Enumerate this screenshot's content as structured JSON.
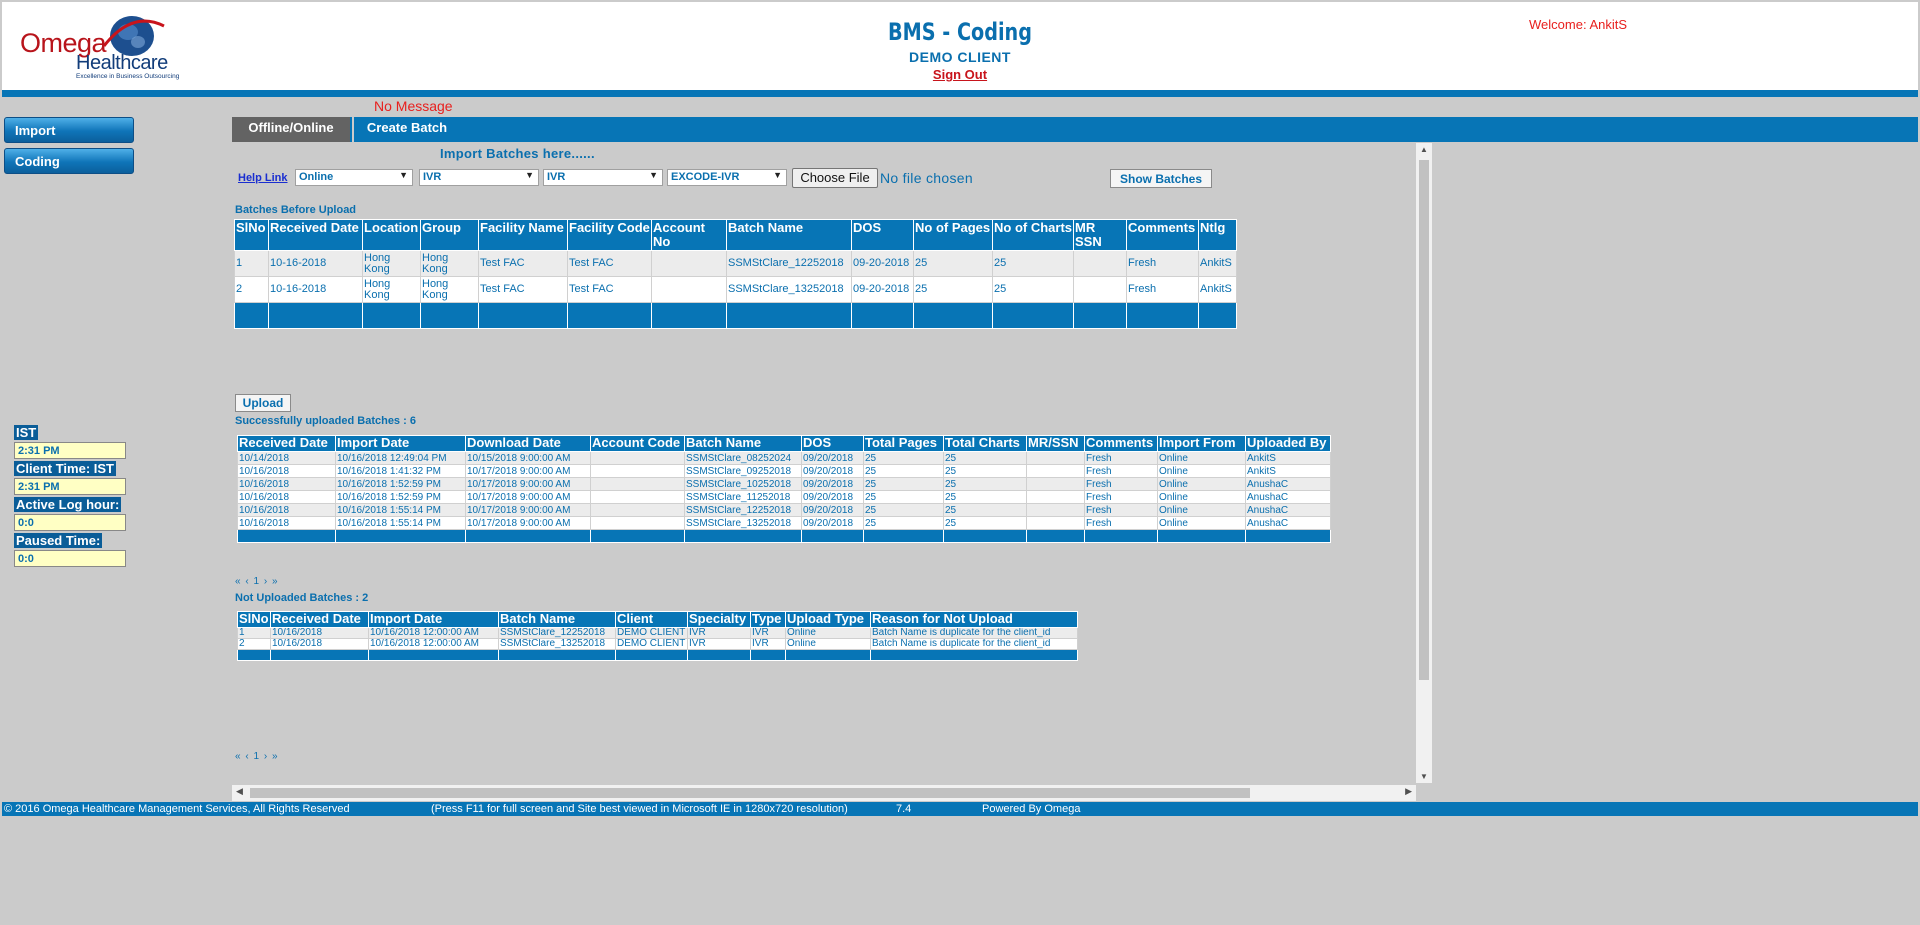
{
  "header": {
    "logo_line1": "Omega",
    "logo_line2": "Healthcare",
    "logo_tagline": "Excellence in Business Outsourcing",
    "app_title": "BMS - Coding",
    "client_name": "DEMO CLIENT",
    "sign_out": "Sign Out",
    "welcome": "Welcome: AnkitS"
  },
  "nav": {
    "import": "Import",
    "coding": "Coding"
  },
  "message": "No Message",
  "tabs": {
    "offline_online": "Offline/Online",
    "create_batch": "Create Batch"
  },
  "import_form": {
    "heading": "Import Batches here......",
    "help_link": "Help Link",
    "mode": "Online",
    "specialty": "IVR",
    "type": "IVR",
    "client": "EXCODE-IVR",
    "choose_file": "Choose File",
    "file_status": "No file chosen",
    "show_batches": "Show Batches"
  },
  "before_upload": {
    "label": "Batches Before Upload",
    "headers": [
      "SlNo",
      "Received Date",
      "Location",
      "Group",
      "Facility Name",
      "Facility Code",
      "Account No",
      "Batch Name",
      "DOS",
      "No of Pages",
      "No of Charts",
      "MR SSN",
      "Comments",
      "Ntlg"
    ],
    "rows": [
      [
        "1",
        "10-16-2018",
        "Hong Kong",
        "Hong Kong",
        "Test FAC",
        "Test FAC",
        "",
        "SSMStClare_12252018",
        "09-20-2018",
        "25",
        "25",
        "",
        "Fresh",
        "AnkitS"
      ],
      [
        "2",
        "10-16-2018",
        "Hong Kong",
        "Hong Kong",
        "Test FAC",
        "Test FAC",
        "",
        "SSMStClare_13252018",
        "09-20-2018",
        "25",
        "25",
        "",
        "Fresh",
        "AnkitS"
      ]
    ]
  },
  "upload_button": "Upload",
  "success": {
    "label": "Successfully uploaded Batches : 6",
    "headers": [
      "Received Date",
      "Import Date",
      "Download Date",
      "Account Code",
      "Batch Name",
      "DOS",
      "Total Pages",
      "Total Charts",
      "MR/SSN",
      "Comments",
      "Import From",
      "Uploaded By"
    ],
    "rows": [
      [
        "10/14/2018",
        "10/16/2018 12:49:04 PM",
        "10/15/2018 9:00:00 AM",
        "",
        "SSMStClare_08252024",
        "09/20/2018",
        "25",
        "25",
        "",
        "Fresh",
        "Online",
        "AnkitS"
      ],
      [
        "10/16/2018",
        "10/16/2018 1:41:32 PM",
        "10/17/2018 9:00:00 AM",
        "",
        "SSMStClare_09252018",
        "09/20/2018",
        "25",
        "25",
        "",
        "Fresh",
        "Online",
        "AnkitS"
      ],
      [
        "10/16/2018",
        "10/16/2018 1:52:59 PM",
        "10/17/2018 9:00:00 AM",
        "",
        "SSMStClare_10252018",
        "09/20/2018",
        "25",
        "25",
        "",
        "Fresh",
        "Online",
        "AnushaC"
      ],
      [
        "10/16/2018",
        "10/16/2018 1:52:59 PM",
        "10/17/2018 9:00:00 AM",
        "",
        "SSMStClare_11252018",
        "09/20/2018",
        "25",
        "25",
        "",
        "Fresh",
        "Online",
        "AnushaC"
      ],
      [
        "10/16/2018",
        "10/16/2018 1:55:14 PM",
        "10/17/2018 9:00:00 AM",
        "",
        "SSMStClare_12252018",
        "09/20/2018",
        "25",
        "25",
        "",
        "Fresh",
        "Online",
        "AnushaC"
      ],
      [
        "10/16/2018",
        "10/16/2018 1:55:14 PM",
        "10/17/2018 9:00:00 AM",
        "",
        "SSMStClare_13252018",
        "09/20/2018",
        "25",
        "25",
        "",
        "Fresh",
        "Online",
        "AnushaC"
      ]
    ]
  },
  "pager1": {
    "first": "«",
    "prev": "‹",
    "page": "1",
    "next": "›",
    "last": "»"
  },
  "not_uploaded": {
    "label": "Not Uploaded Batches : 2",
    "headers": [
      "SlNo",
      "Received Date",
      "Import Date",
      "Batch Name",
      "Client",
      "Specialty",
      "Type",
      "Upload Type",
      "Reason for Not Upload"
    ],
    "rows": [
      [
        "1",
        "10/16/2018",
        "10/16/2018 12:00:00 AM",
        "SSMStClare_12252018",
        "DEMO CLIENT",
        "IVR",
        "IVR",
        "Online",
        "Batch Name is duplicate for the client_id"
      ],
      [
        "2",
        "10/16/2018",
        "10/16/2018 12:00:00 AM",
        "SSMStClare_13252018",
        "DEMO CLIENT",
        "IVR",
        "IVR",
        "Online",
        "Batch Name is duplicate for the client_id"
      ]
    ]
  },
  "pager2": {
    "first": "«",
    "prev": "‹",
    "page": "1",
    "next": "›",
    "last": "»"
  },
  "timing": {
    "ist_label": "IST",
    "ist_value": "2:31 PM",
    "client_time_label": "Client Time: IST",
    "client_time_value": "2:31 PM",
    "active_log_label": "Active Log hour:",
    "active_log_value": "0:0",
    "paused_label": "Paused Time:",
    "paused_value": "0:0"
  },
  "footer": {
    "copyright": "© 2016 Omega Healthcare Management Services, All Rights Reserved",
    "notice": "(Press F11 for full screen and Site best viewed in Microsoft IE in 1280x720 resolution)",
    "version": "7.4",
    "powered": "Powered By Omega"
  },
  "colors": {
    "brand_blue": "#0775b6",
    "text_blue": "#0a6fae",
    "alert_red": "#e8201e",
    "page_bg": "#cbcbcb"
  }
}
